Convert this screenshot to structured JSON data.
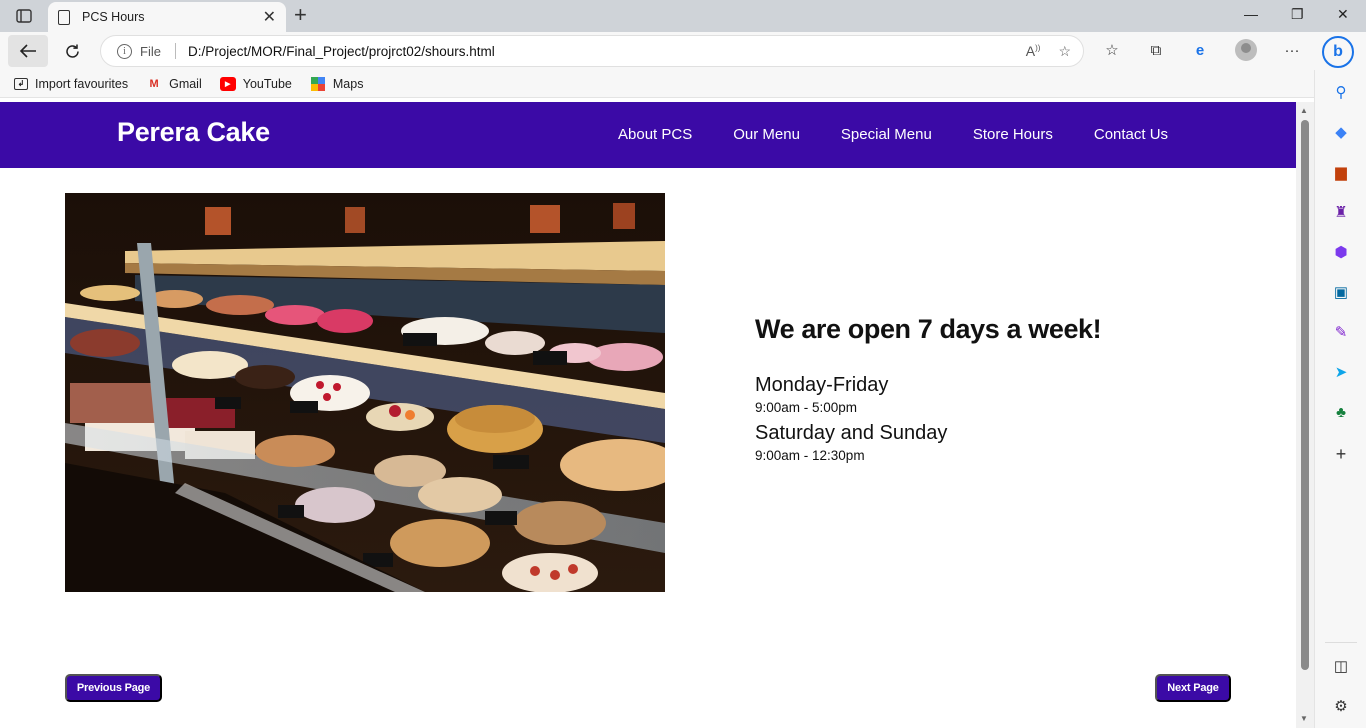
{
  "browser": {
    "tab_title": "PCS Hours",
    "file_label": "File",
    "url": "D:/Project/MOR/Final_Project/projrct02/shours.html",
    "favorites": [
      {
        "label": "Import favourites",
        "icon": "import-icon"
      },
      {
        "label": "Gmail",
        "icon": "gmail-icon"
      },
      {
        "label": "YouTube",
        "icon": "youtube-icon"
      },
      {
        "label": "Maps",
        "icon": "maps-icon"
      }
    ]
  },
  "site": {
    "logo": "Perera Cake",
    "nav": [
      "About PCS",
      "Our Menu",
      "Special Menu",
      "Store Hours",
      "Contact Us"
    ],
    "brand_color": "#3b0aa6"
  },
  "hours": {
    "heading": "We are open 7 days a week!",
    "weekday_label": "Monday-Friday",
    "weekday_time": "9:00am - 5:00pm",
    "weekend_label": "Saturday and Sunday",
    "weekend_time": "9:00am - 12:30pm"
  },
  "pager": {
    "prev": "Previous Page",
    "next": "Next Page"
  },
  "photo": {
    "subject": "bakery display case with cakes and cookies"
  }
}
